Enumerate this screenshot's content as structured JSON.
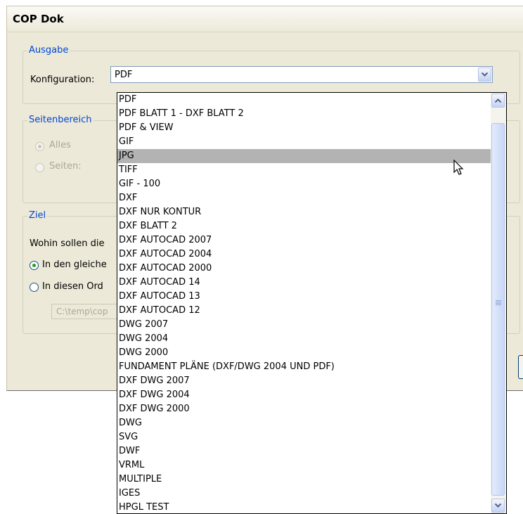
{
  "window": {
    "title": "COP Dok"
  },
  "ausgabe": {
    "legend": "Ausgabe",
    "konfiguration_label": "Konfiguration:",
    "konfiguration_value": "PDF"
  },
  "seitenbereich": {
    "legend": "Seitenbereich",
    "alles_label": "Alles",
    "seiten_label": "Seiten:"
  },
  "ziel": {
    "legend": "Ziel",
    "question": "Wohin sollen die",
    "option_same": "In den gleiche",
    "option_folder": "In diesen Ord",
    "path_value": "C:\\temp\\cop"
  },
  "dropdown": {
    "highlighted_index": 4,
    "options": [
      "PDF",
      "PDF BLATT 1 - DXF BLATT 2",
      "PDF & VIEW",
      "GIF",
      "JPG",
      "TIFF",
      "GIF - 100",
      "DXF",
      "DXF NUR KONTUR",
      "DXF BLATT 2",
      "DXF AUTOCAD 2007",
      "DXF AUTOCAD 2004",
      "DXF AUTOCAD 2000",
      "DXF AUTOCAD 14",
      "DXF AUTOCAD 13",
      "DXF AUTOCAD 12",
      "DWG 2007",
      "DWG 2004",
      "DWG 2000",
      "FUNDAMENT PLÄNE (DXF/DWG 2004 UND PDF)",
      "DXF DWG 2007",
      "DXF DWG 2004",
      "DXF DWG 2000",
      "DWG",
      "SVG",
      "DWF",
      "VRML",
      "MULTIPLE",
      "IGES",
      "HPGL TEST"
    ]
  },
  "icons": {
    "combo_arrow": "chevron-down-icon",
    "scroll_up": "chevron-up-icon",
    "scroll_down": "chevron-down-icon",
    "cursor": "mouse-pointer-icon"
  },
  "colors": {
    "dialog_bg": "#ece9d8",
    "legend_text": "#0046d5",
    "highlight": "#b3b3b3",
    "scroll_button": "#c4d3f4"
  }
}
